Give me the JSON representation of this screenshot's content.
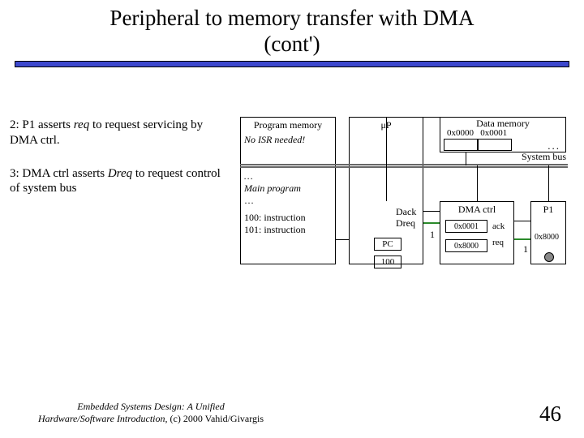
{
  "title_line1": "Peripheral to memory transfer with DMA",
  "title_line2": "(cont')",
  "steps": {
    "s2_pre": "2: P1 asserts ",
    "s2_em": "req",
    "s2_post": " to request servicing by DMA ctrl.",
    "s3_pre": "3: DMA ctrl asserts ",
    "s3_em": "Dreq",
    "s3_post": " to request control of system bus"
  },
  "progmem": {
    "header": "Program memory",
    "no_isr": "No ISR needed!",
    "dots1": "…",
    "main": "Main program",
    "dots2": "…",
    "inst100": "100: instruction",
    "inst101": "101: instruction"
  },
  "mup": {
    "header": "μP",
    "pc_label": "PC",
    "pc_value": "100"
  },
  "datamem": {
    "header": "Data memory",
    "addr0": "0x0000",
    "addr1": "0x0001",
    "dots": "..."
  },
  "sysbus": "System bus",
  "dmactrl": {
    "header": "DMA ctrl",
    "reg1": "0x0001",
    "reg2": "0x8000",
    "ack": "ack",
    "req": "req"
  },
  "p1": {
    "header": "P1",
    "addr": "0x8000"
  },
  "signals": {
    "dack": "Dack",
    "dreq": "Dreq",
    "one1": "1",
    "one2": "1"
  },
  "footer": {
    "left_line1": "Embedded Systems Design: A Unified",
    "left_line2": "Hardware/Software Introduction,",
    "left_line3": " (c) 2000 Vahid/Givargis",
    "right": "46"
  }
}
